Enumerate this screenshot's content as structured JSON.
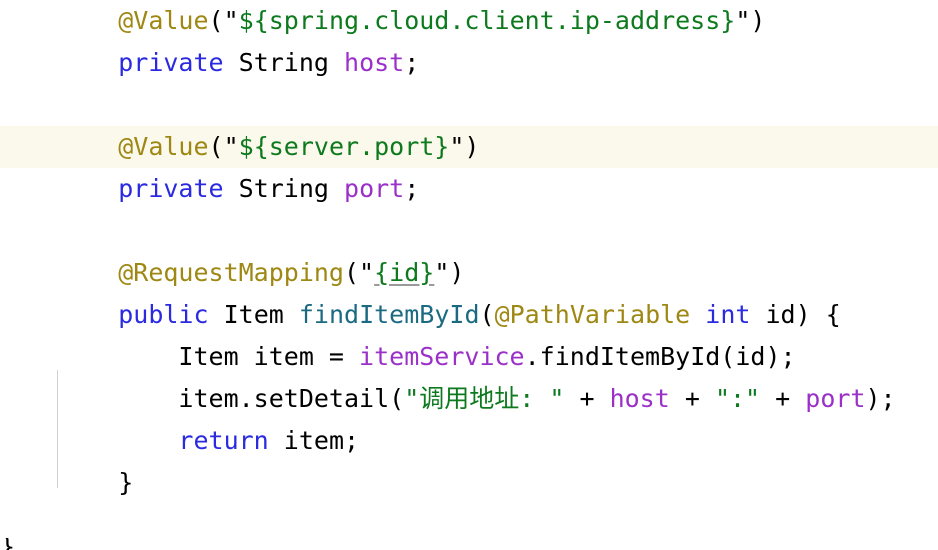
{
  "editor": {
    "language": "java",
    "background_color": "#ffffff",
    "highlight_color": "#fbf8ec",
    "indent_guide_color": "#d0d0d0",
    "font_size_px": 25,
    "line_height_px": 42
  },
  "palette": {
    "annotation": "#9e8813",
    "keyword": "#2a2ae0",
    "type": "#000000",
    "field": "#9b30c8",
    "method": "#1c6a82",
    "string": "#0d7a1e",
    "plain": "#000000",
    "underline": "#9a9a9a"
  },
  "code": {
    "lines": [
      {
        "id": "line-value-ip",
        "highlighted": false,
        "indent": "    ",
        "tokens": [
          {
            "t": "@Value",
            "k": "annotation"
          },
          {
            "t": "(\"",
            "k": "plain"
          },
          {
            "t": "${spring.cloud.client.ip-address}",
            "k": "string"
          },
          {
            "t": "\")",
            "k": "plain"
          }
        ]
      },
      {
        "id": "line-private-host",
        "highlighted": false,
        "indent": "    ",
        "tokens": [
          {
            "t": "private",
            "k": "keyword"
          },
          {
            "t": " ",
            "k": "plain"
          },
          {
            "t": "String",
            "k": "type"
          },
          {
            "t": " ",
            "k": "plain"
          },
          {
            "t": "host",
            "k": "field"
          },
          {
            "t": ";",
            "k": "plain"
          }
        ]
      },
      {
        "id": "line-blank-1",
        "highlighted": false,
        "indent": "",
        "tokens": []
      },
      {
        "id": "line-value-port",
        "highlighted": true,
        "indent": "    ",
        "tokens": [
          {
            "t": "@Value",
            "k": "annotation"
          },
          {
            "t": "(\"",
            "k": "plain"
          },
          {
            "t": "${server.port}",
            "k": "string"
          },
          {
            "t": "\")",
            "k": "plain"
          }
        ]
      },
      {
        "id": "line-private-port",
        "highlighted": false,
        "indent": "    ",
        "tokens": [
          {
            "t": "private",
            "k": "keyword"
          },
          {
            "t": " ",
            "k": "plain"
          },
          {
            "t": "String",
            "k": "type"
          },
          {
            "t": " ",
            "k": "plain"
          },
          {
            "t": "port",
            "k": "field"
          },
          {
            "t": ";",
            "k": "plain"
          }
        ]
      },
      {
        "id": "line-blank-2",
        "highlighted": false,
        "indent": "",
        "tokens": []
      },
      {
        "id": "line-request-mapping",
        "highlighted": false,
        "indent": "    ",
        "tokens": [
          {
            "t": "@RequestMapping",
            "k": "annotation"
          },
          {
            "t": "(\"",
            "k": "plain"
          },
          {
            "t": "{id}",
            "k": "url"
          },
          {
            "t": "\")",
            "k": "plain"
          }
        ]
      },
      {
        "id": "line-method-signature",
        "highlighted": false,
        "indent": "    ",
        "tokens": [
          {
            "t": "public",
            "k": "keyword"
          },
          {
            "t": " ",
            "k": "plain"
          },
          {
            "t": "Item",
            "k": "type"
          },
          {
            "t": " ",
            "k": "plain"
          },
          {
            "t": "findItemById",
            "k": "method"
          },
          {
            "t": "(",
            "k": "plain"
          },
          {
            "t": "@PathVariable",
            "k": "annotation"
          },
          {
            "t": " ",
            "k": "plain"
          },
          {
            "t": "int",
            "k": "keyword"
          },
          {
            "t": " id) {",
            "k": "plain"
          }
        ]
      },
      {
        "id": "line-find-item",
        "highlighted": false,
        "indent": "        ",
        "tokens": [
          {
            "t": "Item item = ",
            "k": "plain"
          },
          {
            "t": "itemService",
            "k": "field"
          },
          {
            "t": ".findItemById(id);",
            "k": "plain"
          }
        ]
      },
      {
        "id": "line-set-detail",
        "highlighted": false,
        "indent": "        ",
        "tokens": [
          {
            "t": "item.setDetail(",
            "k": "plain"
          },
          {
            "t": "\"调用地址: \"",
            "k": "string"
          },
          {
            "t": " + ",
            "k": "plain"
          },
          {
            "t": "host",
            "k": "field"
          },
          {
            "t": " + ",
            "k": "plain"
          },
          {
            "t": "\":\"",
            "k": "string"
          },
          {
            "t": " + ",
            "k": "plain"
          },
          {
            "t": "port",
            "k": "field"
          },
          {
            "t": ");",
            "k": "plain"
          }
        ]
      },
      {
        "id": "line-return",
        "highlighted": false,
        "indent": "        ",
        "tokens": [
          {
            "t": "return",
            "k": "keyword"
          },
          {
            "t": " item;",
            "k": "plain"
          }
        ]
      },
      {
        "id": "line-close-brace",
        "highlighted": false,
        "indent": "    ",
        "tokens": [
          {
            "t": "}",
            "k": "plain"
          }
        ]
      }
    ],
    "clipped_bottom_glyph": "}"
  }
}
